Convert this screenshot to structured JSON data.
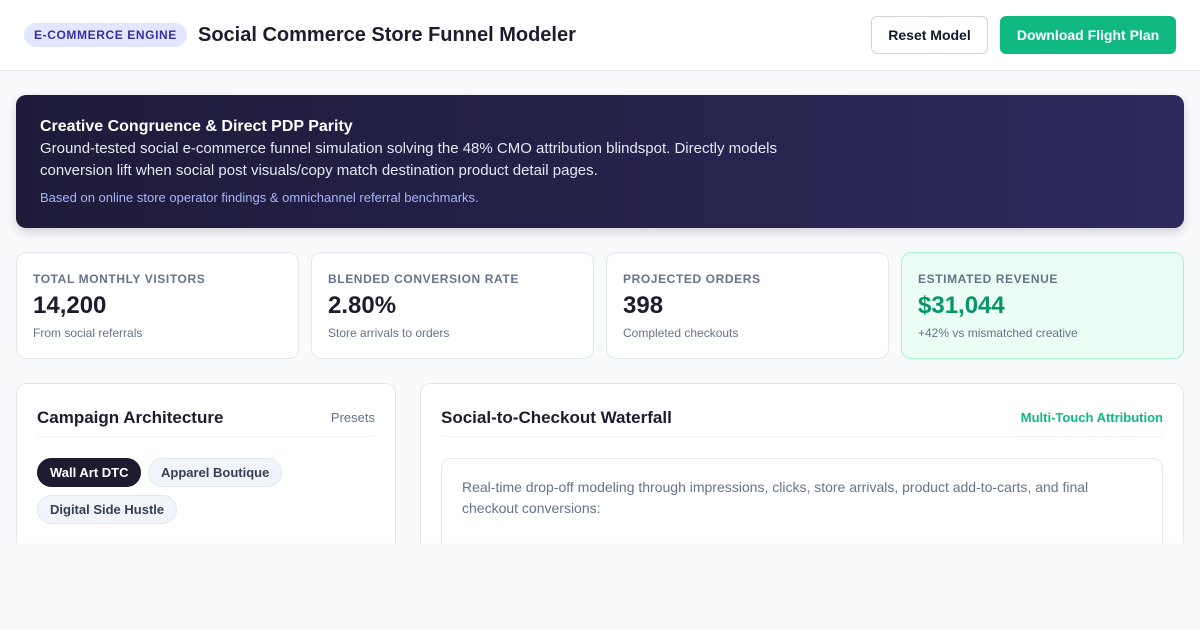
{
  "header": {
    "badge": "E-Commerce Engine",
    "title": "Social Commerce Store Funnel Modeler",
    "reset_label": "Reset Model",
    "download_label": "Download Flight Plan"
  },
  "hero": {
    "title": "Creative Congruence & Direct PDP Parity",
    "description": "Ground-tested social e-commerce funnel simulation solving the 48% CMO attribution blindspot. Directly models conversion lift when social post visuals/copy match destination product detail pages.",
    "note": "Based on online store operator findings & omnichannel referral benchmarks."
  },
  "stats": [
    {
      "label": "Total Monthly Visitors",
      "value": "14,200",
      "sub": "From social referrals"
    },
    {
      "label": "Blended Conversion Rate",
      "value": "2.80%",
      "sub": "Store arrivals to orders"
    },
    {
      "label": "Projected Orders",
      "value": "398",
      "sub": "Completed checkouts"
    },
    {
      "label": "Estimated Revenue",
      "value": "$31,044",
      "sub": "+42% vs mismatched creative"
    }
  ],
  "colors": {
    "accent": "#10b981",
    "hero_bg": "#1e1b3a",
    "badge_bg": "#e0e7ff"
  },
  "campaign": {
    "title": "Campaign Architecture",
    "presets_label": "Presets",
    "chips": [
      {
        "label": "Wall Art DTC"
      },
      {
        "label": "Apparel Boutique"
      },
      {
        "label": "Digital Side Hustle"
      }
    ]
  },
  "waterfall": {
    "title": "Social-to-Checkout Waterfall",
    "attribution_label": "Multi-Touch Attribution",
    "description": "Real-time drop-off modeling through impressions, clicks, store arrivals, product add-to-carts, and final checkout conversions:"
  }
}
